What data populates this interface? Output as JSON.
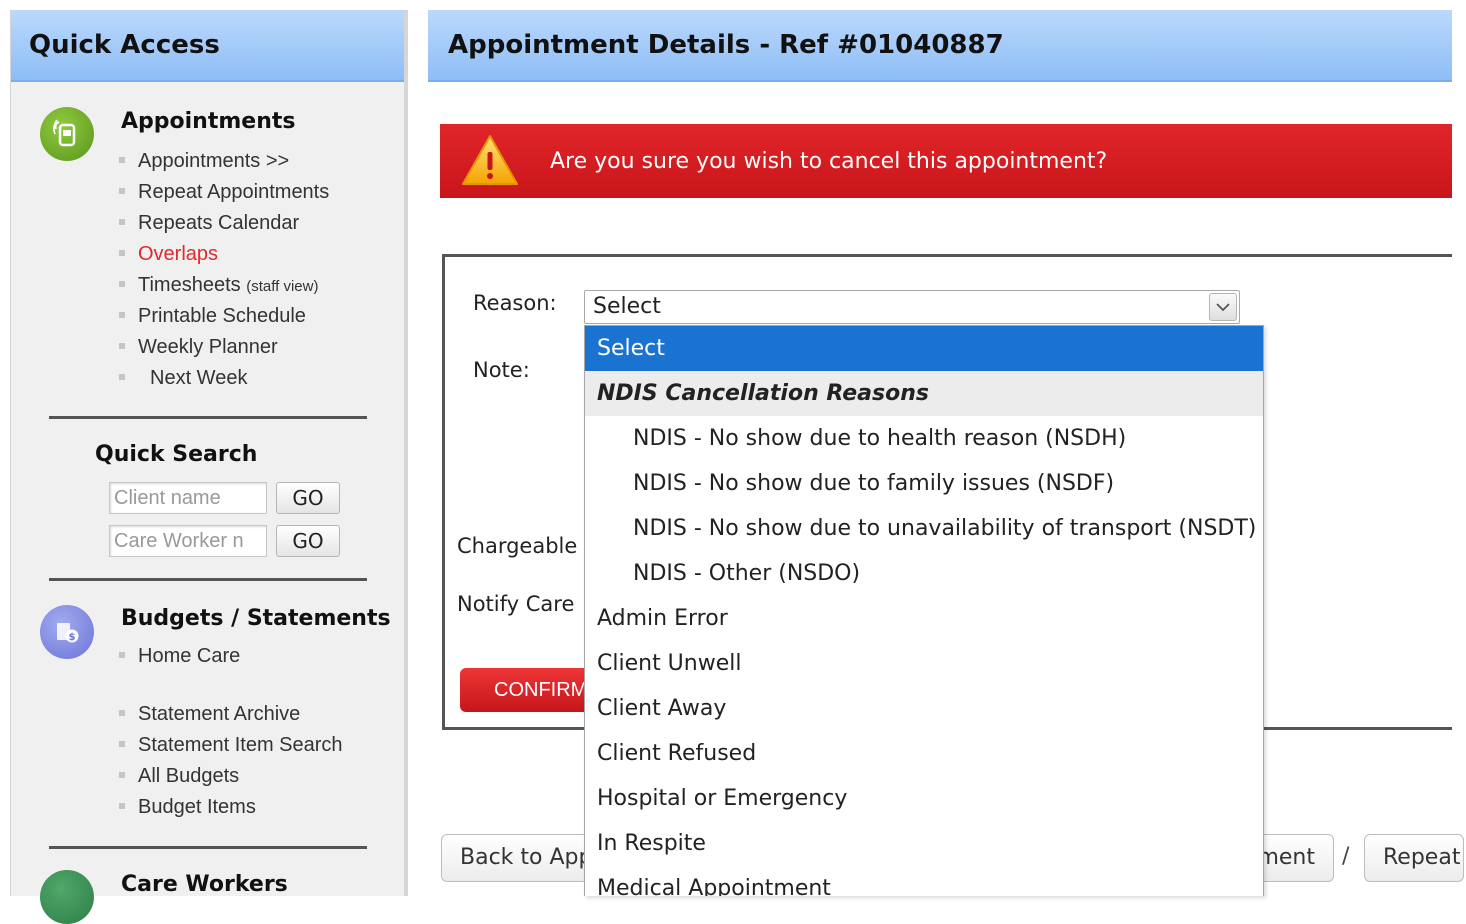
{
  "sidebar": {
    "title": "Quick Access",
    "appointments": {
      "title": "Appointments",
      "items": [
        "Appointments >>",
        "Repeat Appointments",
        "Repeats Calendar",
        "Overlaps",
        "Timesheets",
        "Printable Schedule",
        "Weekly Planner",
        "Next Week"
      ],
      "timesheets_suffix": "(staff view)"
    },
    "quick_search": {
      "title": "Quick Search",
      "client_placeholder": "Client name",
      "worker_placeholder": "Care Worker n",
      "go_label": "GO"
    },
    "budgets": {
      "title": "Budgets / Statements",
      "items": [
        "Home Care",
        "Statement Archive",
        "Statement Item Search",
        "All Budgets",
        "Budget Items"
      ]
    },
    "care_workers": {
      "title": "Care Workers"
    }
  },
  "main": {
    "title": "Appointment Details - Ref #01040887",
    "alert_text": "Are you sure you wish to cancel this appointment?",
    "form": {
      "reason_label": "Reason:",
      "note_label": "Note:",
      "chargeable_label": "Chargeable",
      "notify_label": "Notify Care",
      "reason_value": "Select",
      "confirm_label": "CONFIRM"
    },
    "bottom": {
      "back_label": "Back to Appointment",
      "middle_label": "Appointment",
      "repeat_label": "Repeat",
      "slash": "/"
    }
  },
  "dropdown": {
    "selected": "Select",
    "group_label": "NDIS Cancellation Reasons",
    "group_items": [
      "NDIS - No show due to health reason (NSDH)",
      "NDIS - No show due to family issues (NSDF)",
      "NDIS - No show due to unavailability of transport (NSDT)",
      "NDIS - Other (NSDO)"
    ],
    "items": [
      "Admin Error",
      "Client Unwell",
      "Client Away",
      "Client Refused",
      "Hospital or Emergency",
      "In Respite",
      "Medical Appointment"
    ]
  },
  "colors": {
    "header_blue": "#8ebdf6",
    "alert_red": "#d41c20",
    "selected_blue": "#1a73d1",
    "link_red": "#e0292b",
    "appointments_icon": "#6aa324",
    "budgets_icon": "#7b86e0",
    "care_workers_icon": "#2e7d46"
  },
  "icons": {
    "appointments": "appointment-phone-icon",
    "budgets": "budget-money-icon",
    "care_workers": "care-worker-icon",
    "alert": "warning-icon",
    "select_arrow": "chevron-down-icon"
  }
}
